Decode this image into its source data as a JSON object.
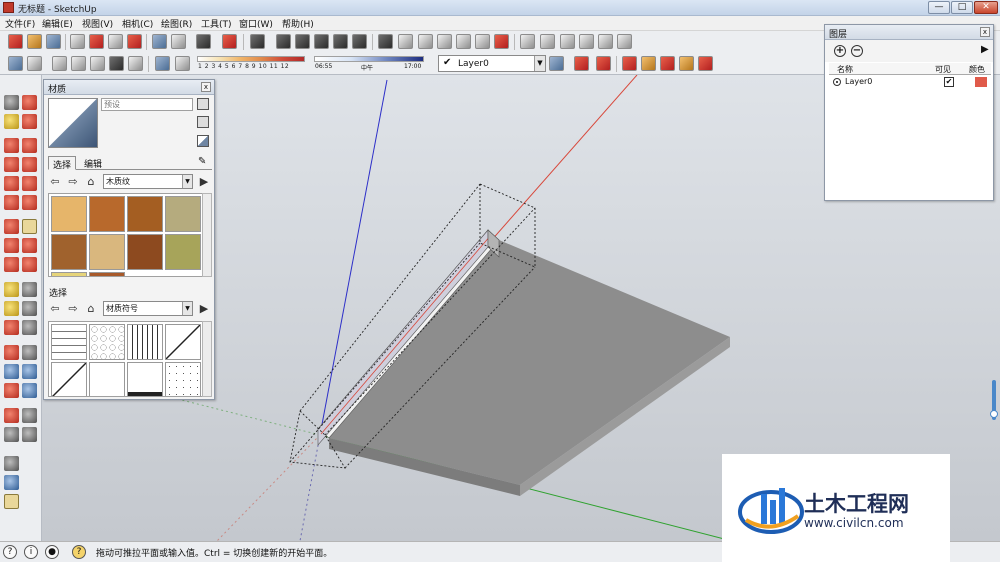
{
  "window": {
    "title": "无标题 - SketchUp",
    "minimize_label": "—",
    "maximize_label": "□",
    "close_label": "✕"
  },
  "menu": {
    "items": [
      "文件(F)",
      "编辑(E)",
      "视图(V)",
      "相机(C)",
      "绘图(R)",
      "工具(T)",
      "窗口(W)",
      "帮助(H)"
    ]
  },
  "toolbar": {
    "shadow_scale_labels": "1 2 3 4 5 6 7 8 9 10 11 12",
    "time_start": "06:55",
    "time_mid": "中午",
    "time_end": "17:00",
    "layer_checkmark": "✔",
    "current_layer": "Layer0"
  },
  "materials_panel": {
    "title": "材质",
    "close": "x",
    "material_name_placeholder": "预设",
    "tabs": [
      "选择",
      "编辑"
    ],
    "top_library": "木质纹",
    "bottom_section_label": "选择",
    "bottom_library": "材质符号",
    "wood_swatches": [
      "#e6b56a",
      "#b8692c",
      "#a45e22",
      "#b5ab7e",
      "#a0622d",
      "#d9b77e",
      "#8d4a1f",
      "#a7a45a"
    ],
    "pattern_swatches": [
      "brick",
      "stone",
      "lines-vertical",
      "dots-diagonal",
      "diagonal-line",
      "blank",
      "hatch",
      "speckle"
    ]
  },
  "layers_panel": {
    "title": "图层",
    "close": "x",
    "add_button": "+",
    "remove_button": "−",
    "col_name": "名称",
    "col_visible": "可见",
    "col_color": "颜色",
    "layers": [
      {
        "name": "Layer0",
        "visible": true,
        "visible_mark": "✔",
        "color": "#e05a4a"
      }
    ]
  },
  "status": {
    "text": "拖动可推拉平面或输入值。Ctrl = 切换创建新的开始平面。",
    "icon_labels": [
      "?",
      "i",
      "●",
      "?"
    ]
  },
  "watermark": {
    "title": "土木工程网",
    "url": "www.civilcn.com"
  },
  "colors": {
    "axis_red": "#d8473a",
    "axis_green": "#2fa22f",
    "axis_blue": "#2d2fc8",
    "slab_top": "#8a8a8a",
    "slab_side": "#9d9d9d"
  }
}
